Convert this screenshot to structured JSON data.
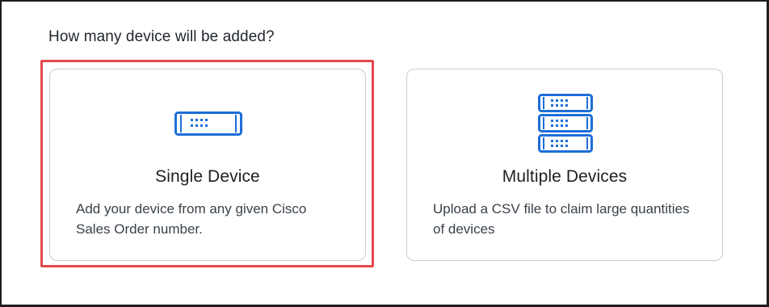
{
  "question": "How many device will be added?",
  "options": [
    {
      "title": "Single Device",
      "description": "Add your device from any given Cisco Sales Order number.",
      "icon": "single-device-icon",
      "selected": true
    },
    {
      "title": "Multiple Devices",
      "description": "Upload a CSV file to claim large quantities of devices",
      "icon": "multiple-devices-icon",
      "selected": false
    }
  ],
  "colors": {
    "accent": "#1d6ed8",
    "highlight": "#e5484d",
    "card_border": "#c9ccd1"
  }
}
